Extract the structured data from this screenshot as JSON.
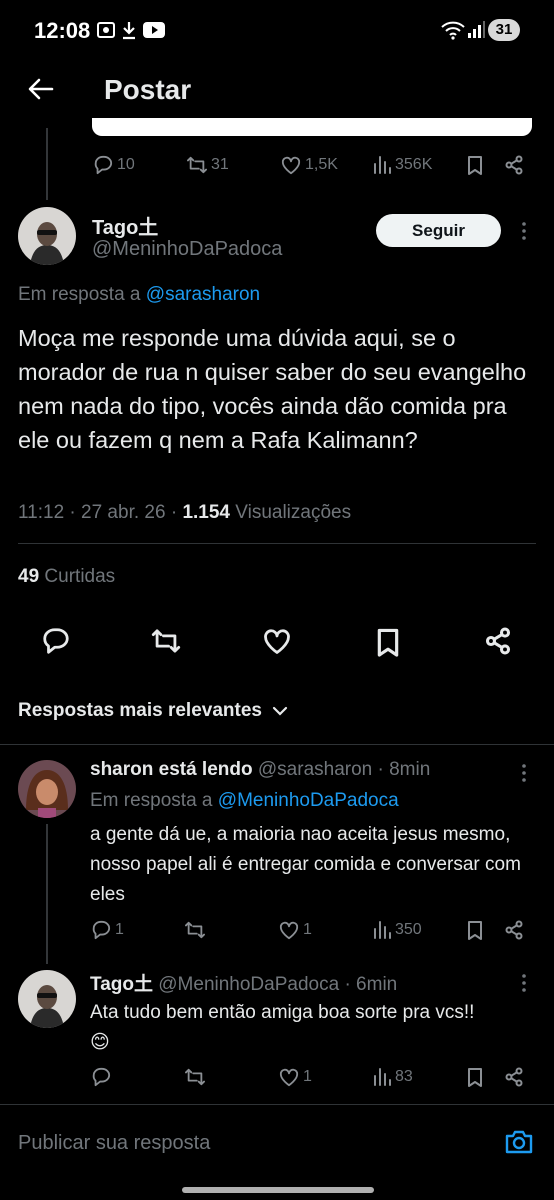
{
  "status_bar": {
    "time": "12:08",
    "battery": "31"
  },
  "header": {
    "title": "Postar"
  },
  "prev_stats": {
    "replies": "10",
    "reposts": "31",
    "likes": "1,5K",
    "views": "356K"
  },
  "main_post": {
    "display_name": "Tago⼟",
    "handle": "@MeninhoDaPadoca",
    "follow_label": "Seguir",
    "reply_prefix": "Em resposta a",
    "reply_to": "@sarasharon",
    "text": "Moça me responde uma dúvida aqui, se o morador de rua n quiser saber do seu evangelho nem nada do tipo, vocês ainda dão comida pra ele ou fazem q nem a Rafa Kalimann?",
    "time": "11:12 · 27 abr. 26 ·",
    "views_count": "1.154",
    "views_label": "Visualizações",
    "likes_count": "49",
    "likes_label": "Curtidas"
  },
  "sort": {
    "label": "Respostas mais relevantes"
  },
  "replies": [
    {
      "display_name": "sharon está lendo",
      "handle_time": "@sarasharon · 8min",
      "reply_prefix": "Em resposta a",
      "reply_to": "@MeninhoDaPadoca",
      "text": "a gente dá ue, a maioria nao aceita jesus mesmo, nosso papel ali é entregar comida e conversar com eles",
      "stats": {
        "replies": "1",
        "reposts": "",
        "likes": "1",
        "views": "350"
      }
    },
    {
      "display_name": "Tago⼟",
      "handle_time": "@MeninhoDaPadoca · 6min",
      "text": "Ata tudo bem então amiga boa sorte pra vcs!!",
      "emoji": "😊",
      "stats": {
        "replies": "",
        "reposts": "",
        "likes": "1",
        "views": "83"
      }
    }
  ],
  "composer": {
    "placeholder": "Publicar sua resposta"
  },
  "colors": {
    "background": "#000000",
    "link": "#1d9bf0",
    "muted": "#71767b",
    "text": "#e7e9ea"
  }
}
